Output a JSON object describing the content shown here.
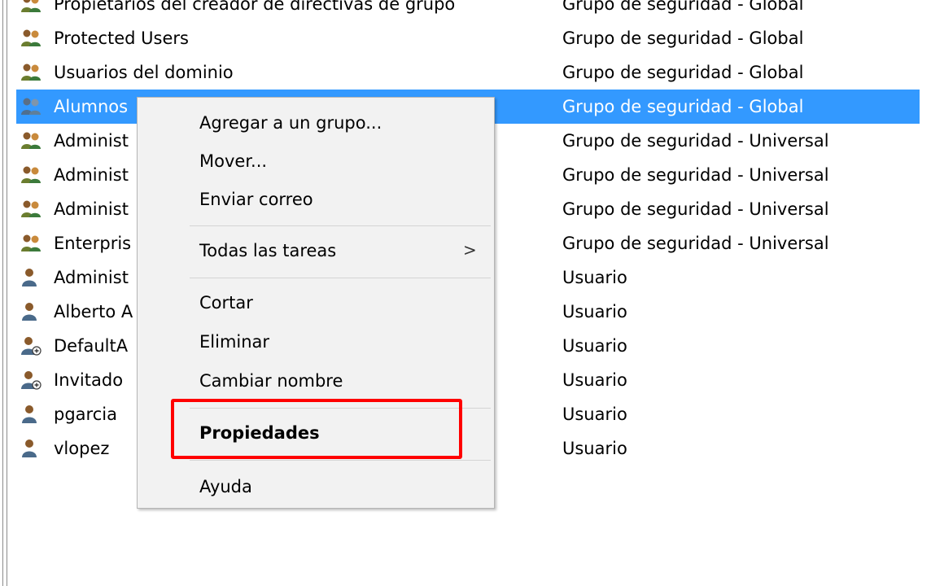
{
  "rows": [
    {
      "name": "Propietarios del creador de directivas de grupo",
      "type": "Grupo de seguridad - Global",
      "icon": "group-icon"
    },
    {
      "name": "Protected Users",
      "type": "Grupo de seguridad - Global",
      "icon": "group-icon"
    },
    {
      "name": "Usuarios del dominio",
      "type": "Grupo de seguridad - Global",
      "icon": "group-icon"
    },
    {
      "name": "Alumnos",
      "type": "Grupo de seguridad - Global",
      "icon": "group-icon",
      "selected": true
    },
    {
      "name": "Administ",
      "type": "Grupo de seguridad - Universal",
      "icon": "group-icon"
    },
    {
      "name": "Administ",
      "type": "Grupo de seguridad - Universal",
      "icon": "group-icon"
    },
    {
      "name": "Administ",
      "type": "Grupo de seguridad - Universal",
      "icon": "group-icon"
    },
    {
      "name": "Enterpris",
      "type": "Grupo de seguridad - Universal",
      "icon": "group-icon"
    },
    {
      "name": "Administ",
      "type": "Usuario",
      "icon": "user-icon"
    },
    {
      "name": "Alberto A",
      "type": "Usuario",
      "icon": "user-icon"
    },
    {
      "name": "DefaultA",
      "type": "Usuario",
      "icon": "disabled-user-icon"
    },
    {
      "name": "Invitado",
      "type": "Usuario",
      "icon": "disabled-user-icon"
    },
    {
      "name": "pgarcia",
      "type": "Usuario",
      "icon": "user-icon"
    },
    {
      "name": "vlopez",
      "type": "Usuario",
      "icon": "user-icon"
    }
  ],
  "context_menu": {
    "add_to_group": "Agregar a un grupo...",
    "move": "Mover...",
    "send_mail": "Enviar correo",
    "all_tasks": "Todas las tareas",
    "submenu_arrow": ">",
    "cut": "Cortar",
    "delete": "Eliminar",
    "rename": "Cambiar nombre",
    "properties": "Propiedades",
    "help": "Ayuda"
  },
  "colors": {
    "selection": "#3399ff",
    "highlight_box": "#ff0000",
    "menu_background": "#f2f2f2"
  }
}
